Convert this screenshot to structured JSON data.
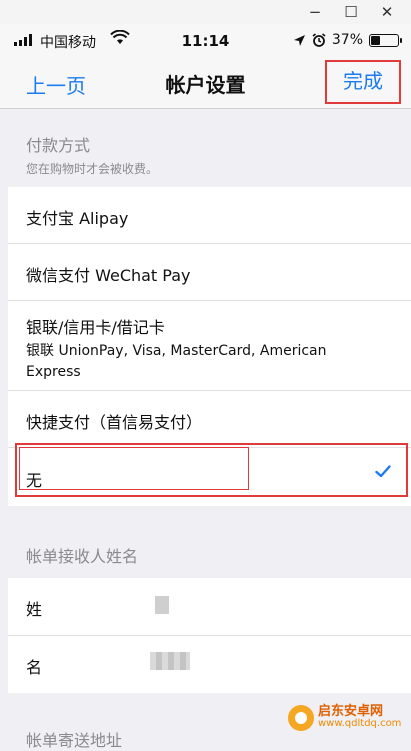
{
  "window": {
    "minimize": "−",
    "maximize": "☐",
    "close": "✕"
  },
  "status": {
    "carrier": "中国移动",
    "time": "11:14",
    "battery": "37%",
    "battery_level": 0.37
  },
  "nav": {
    "back": "上一页",
    "title": "帐户设置",
    "done": "完成"
  },
  "payment": {
    "title": "付款方式",
    "subtitle": "您在购物时才会被收费。",
    "options": [
      {
        "label": "支付宝 Alipay"
      },
      {
        "label": "微信支付 WeChat Pay"
      },
      {
        "label": "银联/信用卡/借记卡",
        "sub1": "银联 UnionPay, Visa, MasterCard, American",
        "sub2": "Express"
      },
      {
        "label": "快捷支付（首信易支付）"
      },
      {
        "label": "无",
        "selected": true
      }
    ]
  },
  "billing_name": {
    "title": "帐单接收人姓名",
    "fields": [
      {
        "label": "姓"
      },
      {
        "label": "名"
      }
    ]
  },
  "billing_address": {
    "title": "帐单寄送地址"
  },
  "watermark": {
    "name": "启东安卓网",
    "url": "www.qdltdq.com"
  },
  "colors": {
    "accent": "#1a7cf0",
    "highlight": "#e03a3a",
    "background": "#efeff4"
  }
}
